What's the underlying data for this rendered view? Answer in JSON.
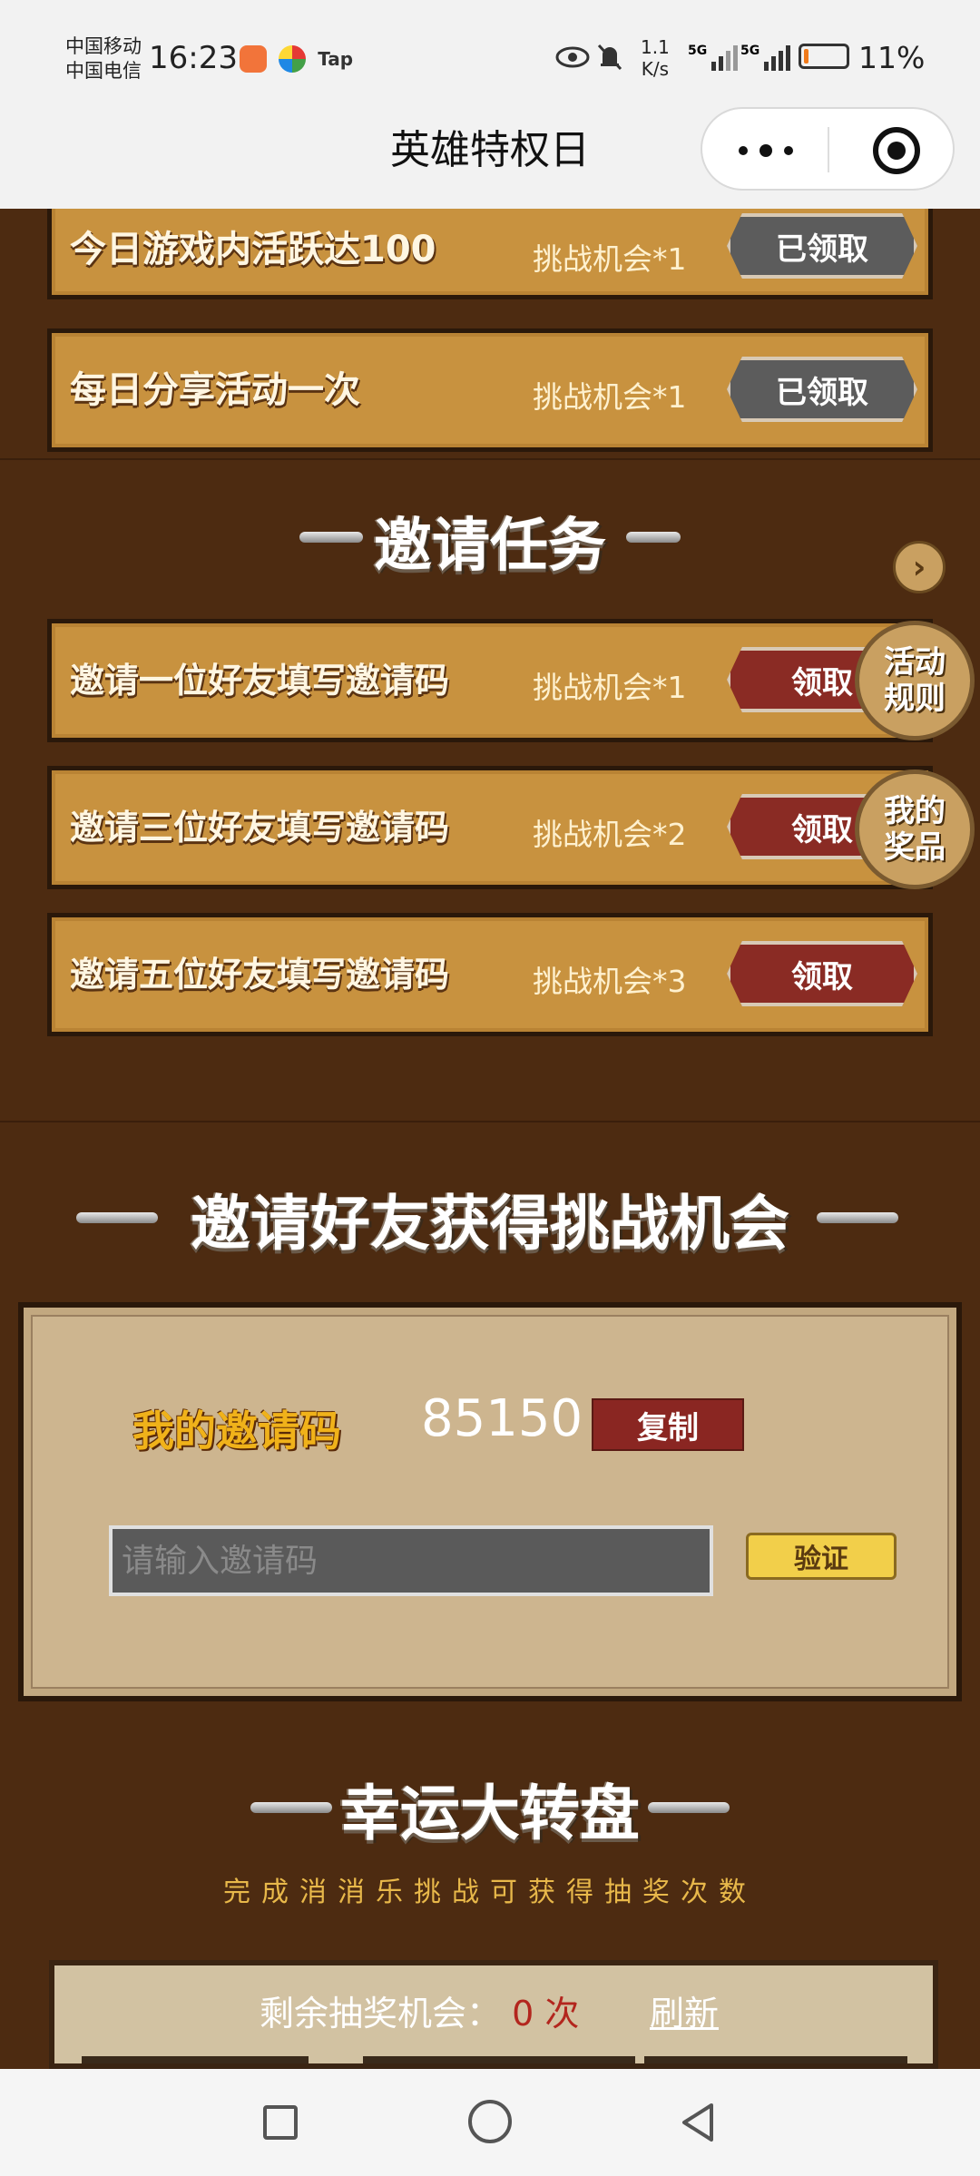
{
  "status_bar": {
    "carrier_1": "中国移动",
    "carrier_2": "中国电信",
    "time": "16:23",
    "app_icon_label": "Tap",
    "net_speed_value": "1.1",
    "net_speed_unit": "K/s",
    "signal_1_label": "5G",
    "signal_2_label": "5G",
    "battery_percent": "11%",
    "battery_level": 0.11,
    "icons": [
      "eye-icon",
      "mute-bell-icon",
      "signal-icon",
      "battery-icon"
    ]
  },
  "title_bar": {
    "title": "英雄特权日",
    "more_icon": "more-dots-icon",
    "close_icon": "target-icon"
  },
  "daily_tasks": [
    {
      "label": "今日游戏内活跃达100",
      "reward": "挑战机会*1",
      "button": "已领取"
    },
    {
      "label": "每日分享活动一次",
      "reward": "挑战机会*1",
      "button": "已领取"
    }
  ],
  "invite_tasks": {
    "title": "邀请任务",
    "items": [
      {
        "label": "邀请一位好友填写邀请码",
        "reward": "挑战机会*1",
        "button": "领取"
      },
      {
        "label": "邀请三位好友填写邀请码",
        "reward": "挑战机会*2",
        "button": "领取"
      },
      {
        "label": "邀请五位好友填写邀请码",
        "reward": "挑战机会*3",
        "button": "领取"
      }
    ]
  },
  "side_buttons": {
    "rules": "活动规则",
    "rules_line1": "活动",
    "rules_line2": "规则",
    "prizes": "我的奖品",
    "prizes_line1": "我的",
    "prizes_line2": "奖品"
  },
  "invite_friends": {
    "title": "邀请好友获得挑战机会",
    "my_code_label": "我的邀请码",
    "my_code": "85150",
    "copy_button": "复制",
    "input_placeholder": "请输入邀请码",
    "verify_button": "验证"
  },
  "lucky_wheel": {
    "title": "幸运大转盘",
    "subtitle": "完成消消乐挑战可获得抽奖次数",
    "remaining_label": "剩余抽奖机会：",
    "remaining_count": "0",
    "remaining_unit": "次",
    "refresh": "刷新"
  },
  "nav_bar": {
    "icons": [
      "square-icon",
      "circle-icon",
      "back-triangle-icon"
    ]
  }
}
